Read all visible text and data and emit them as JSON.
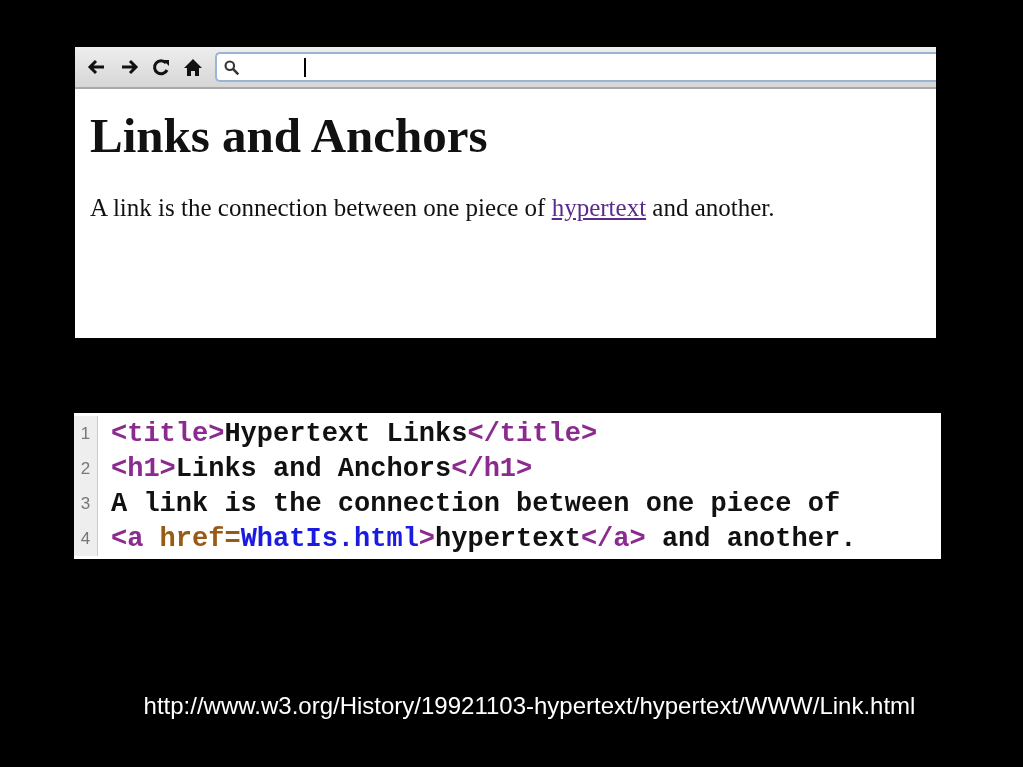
{
  "browser": {
    "heading": "Links and Anchors",
    "paragraph": [
      {
        "kind": "text",
        "text": "A link is the connection between one piece of "
      },
      {
        "kind": "link",
        "text": "hypertext"
      },
      {
        "kind": "text",
        "text": " and another."
      }
    ]
  },
  "code": {
    "lines": [
      {
        "number": "1",
        "tokens": [
          {
            "kind": "tag",
            "text": "<title>"
          },
          {
            "kind": "text",
            "text": "Hypertext Links"
          },
          {
            "kind": "tag",
            "text": "</title>"
          }
        ]
      },
      {
        "number": "2",
        "tokens": [
          {
            "kind": "tag",
            "text": "<h1>"
          },
          {
            "kind": "text",
            "text": "Links and Anchors"
          },
          {
            "kind": "tag",
            "text": "</h1>"
          }
        ]
      },
      {
        "number": "3",
        "tokens": [
          {
            "kind": "text",
            "text": "A link is the connection between one piece of"
          }
        ]
      },
      {
        "number": "4",
        "tokens": [
          {
            "kind": "tag",
            "text": "<a "
          },
          {
            "kind": "attr",
            "text": "href="
          },
          {
            "kind": "value",
            "text": "WhatIs.html"
          },
          {
            "kind": "tag",
            "text": ">"
          },
          {
            "kind": "text",
            "text": "hypertext"
          },
          {
            "kind": "tag",
            "text": "</a>"
          },
          {
            "kind": "text",
            "text": " and another."
          }
        ]
      }
    ]
  },
  "caption": "http://www.w3.org/History/19921103-hypertext/hypertext/WWW/Link.html"
}
